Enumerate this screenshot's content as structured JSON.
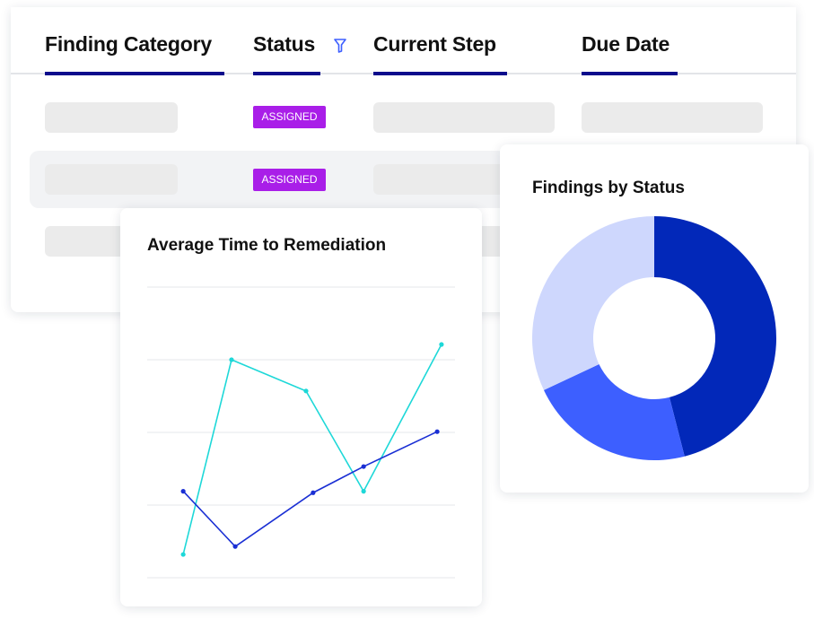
{
  "table": {
    "columns": [
      {
        "label": "Finding Category"
      },
      {
        "label": "Status",
        "icon": "filter-icon"
      },
      {
        "label": "Current Step"
      },
      {
        "label": "Due Date"
      }
    ],
    "rows": [
      {
        "status": "ASSIGNED"
      },
      {
        "status": "ASSIGNED"
      },
      {
        "status": ""
      }
    ],
    "colors": {
      "header_underline": "#0b0c8c",
      "badge": "#a91ee8",
      "skeleton": "#ebebeb"
    }
  },
  "chart_data": [
    {
      "type": "line",
      "title": "Average Time to Remediation",
      "xlabel": "",
      "ylabel": "",
      "xlim": [
        0,
        10
      ],
      "ylim": [
        0,
        4
      ],
      "grid": true,
      "series": [
        {
          "color": "#1ed8d8",
          "x": [
            1.17,
            2.74,
            5.16,
            7.03,
            9.56
          ],
          "y": [
            0.32,
            3.0,
            2.57,
            1.19,
            3.21
          ]
        },
        {
          "color": "#1a2fd4",
          "x": [
            1.17,
            2.86,
            5.39,
            7.03,
            9.42
          ],
          "y": [
            1.19,
            0.43,
            1.17,
            1.53,
            2.01
          ]
        }
      ]
    },
    {
      "type": "pie",
      "title": "Findings by Status",
      "donut": true,
      "values": [
        46,
        22,
        32
      ],
      "colors": [
        "#0228b9",
        "#3d5fff",
        "#ced7fd"
      ]
    }
  ]
}
